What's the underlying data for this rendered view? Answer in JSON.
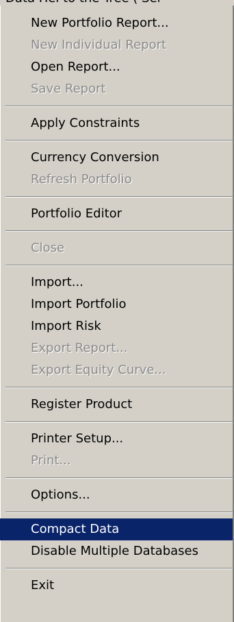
{
  "top_strip_text": "Data Hel to the Tree ( Sel",
  "menu": {
    "groups": [
      {
        "items": [
          {
            "label": "New Portfolio Report...",
            "enabled": true
          },
          {
            "label": "New Individual Report",
            "enabled": false
          },
          {
            "label": "Open Report...",
            "enabled": true
          },
          {
            "label": "Save Report",
            "enabled": false
          }
        ]
      },
      {
        "items": [
          {
            "label": "Apply Constraints",
            "enabled": true
          }
        ]
      },
      {
        "items": [
          {
            "label": "Currency Conversion",
            "enabled": true
          },
          {
            "label": "Refresh Portfolio",
            "enabled": false
          }
        ]
      },
      {
        "items": [
          {
            "label": "Portfolio Editor",
            "enabled": true
          }
        ]
      },
      {
        "items": [
          {
            "label": "Close",
            "enabled": false
          }
        ]
      },
      {
        "items": [
          {
            "label": "Import...",
            "enabled": true
          },
          {
            "label": "Import Portfolio",
            "enabled": true
          },
          {
            "label": "Import Risk",
            "enabled": true
          },
          {
            "label": "Export Report...",
            "enabled": false
          },
          {
            "label": "Export Equity Curve...",
            "enabled": false
          }
        ]
      },
      {
        "items": [
          {
            "label": "Register Product",
            "enabled": true
          }
        ]
      },
      {
        "items": [
          {
            "label": "Printer Setup...",
            "enabled": true
          },
          {
            "label": "Print...",
            "enabled": false
          }
        ]
      },
      {
        "items": [
          {
            "label": "Options...",
            "enabled": true
          }
        ]
      },
      {
        "items": [
          {
            "label": "Compact Data",
            "enabled": true,
            "highlighted": true
          },
          {
            "label": "Disable Multiple Databases",
            "enabled": true
          }
        ]
      },
      {
        "items": [
          {
            "label": "Exit",
            "enabled": true
          }
        ]
      }
    ]
  },
  "colors": {
    "menu_background": "#d4d0c8",
    "highlight_background": "#0a246a",
    "highlight_text": "#ffffff",
    "disabled_text": "#8a8a8a"
  }
}
